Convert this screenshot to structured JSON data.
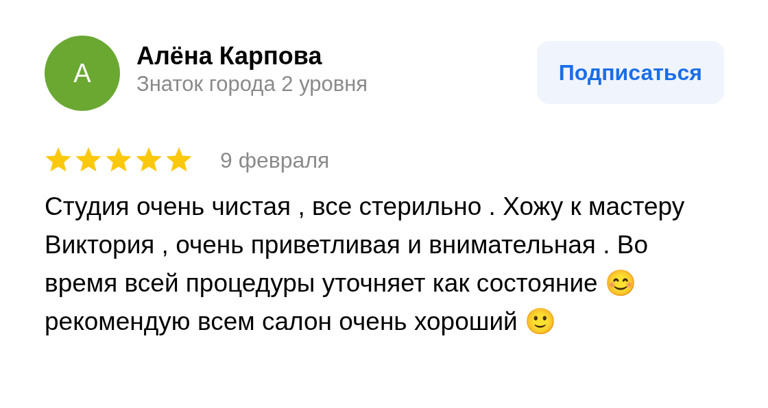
{
  "author": {
    "initial": "А",
    "name": "Алёна Карпова",
    "level": "Знаток города 2 уровня"
  },
  "subscribe_button": "Подписаться",
  "review": {
    "stars": 5,
    "date": "9 февраля",
    "text": "Студия очень чистая , все стерильно . Хожу к мастеру Виктория , очень приветливая и внимательная . Во время всей процедуры уточняет как состояние 😊 рекомендую всем салон очень хороший 🙂"
  }
}
